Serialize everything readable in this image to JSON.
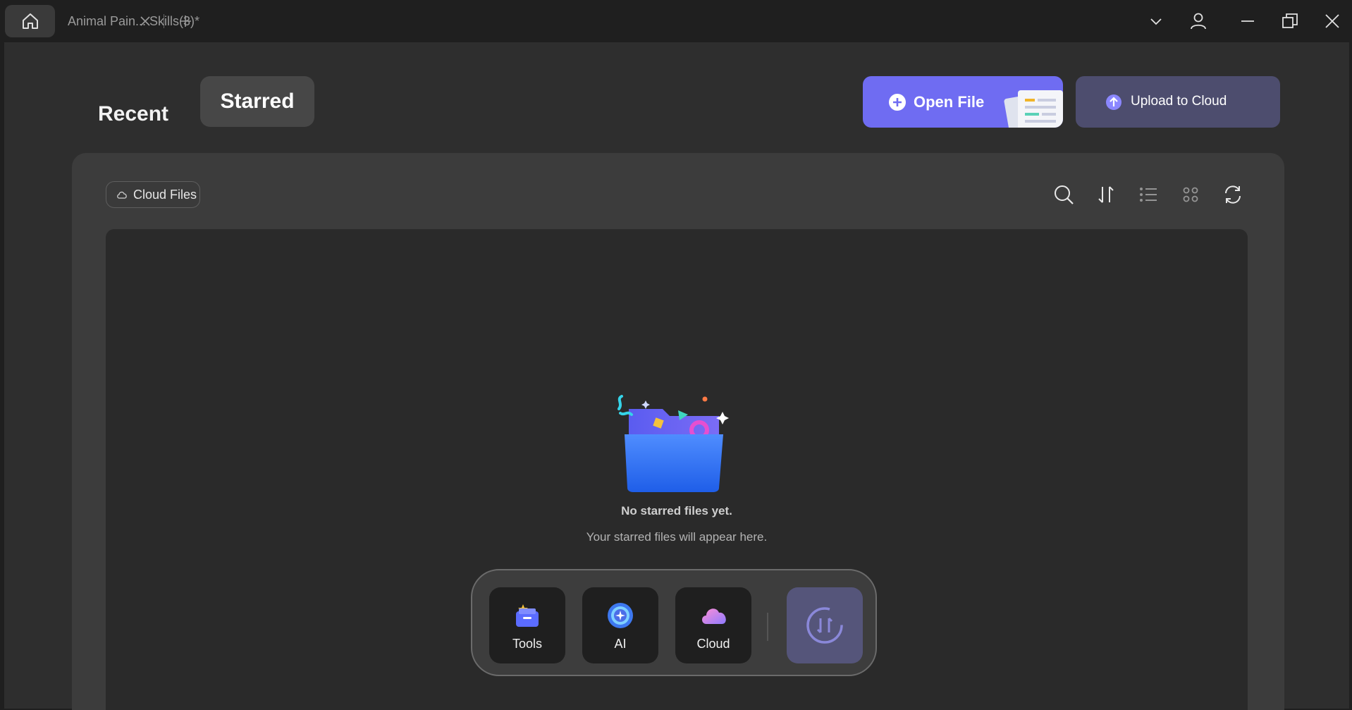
{
  "titlebar": {
    "tab_title": "Animal Pain... Skills(3)*"
  },
  "nav": {
    "recent_label": "Recent",
    "starred_label": "Starred"
  },
  "actions": {
    "open_file_label": "Open File",
    "upload_label": "Upload to Cloud"
  },
  "panel": {
    "cloud_files_label": "Cloud Files",
    "empty_title": "No starred files yet.",
    "empty_subtitle": "Your starred files will appear here."
  },
  "dock": {
    "items": [
      {
        "label": "Tools",
        "icon": "tools-icon"
      },
      {
        "label": "AI",
        "icon": "ai-icon"
      },
      {
        "label": "Cloud",
        "icon": "cloud-icon"
      }
    ]
  },
  "colors": {
    "accent": "#6f6cf2",
    "upload_bg": "#4d4d6e",
    "background": "#2e2e2e"
  }
}
